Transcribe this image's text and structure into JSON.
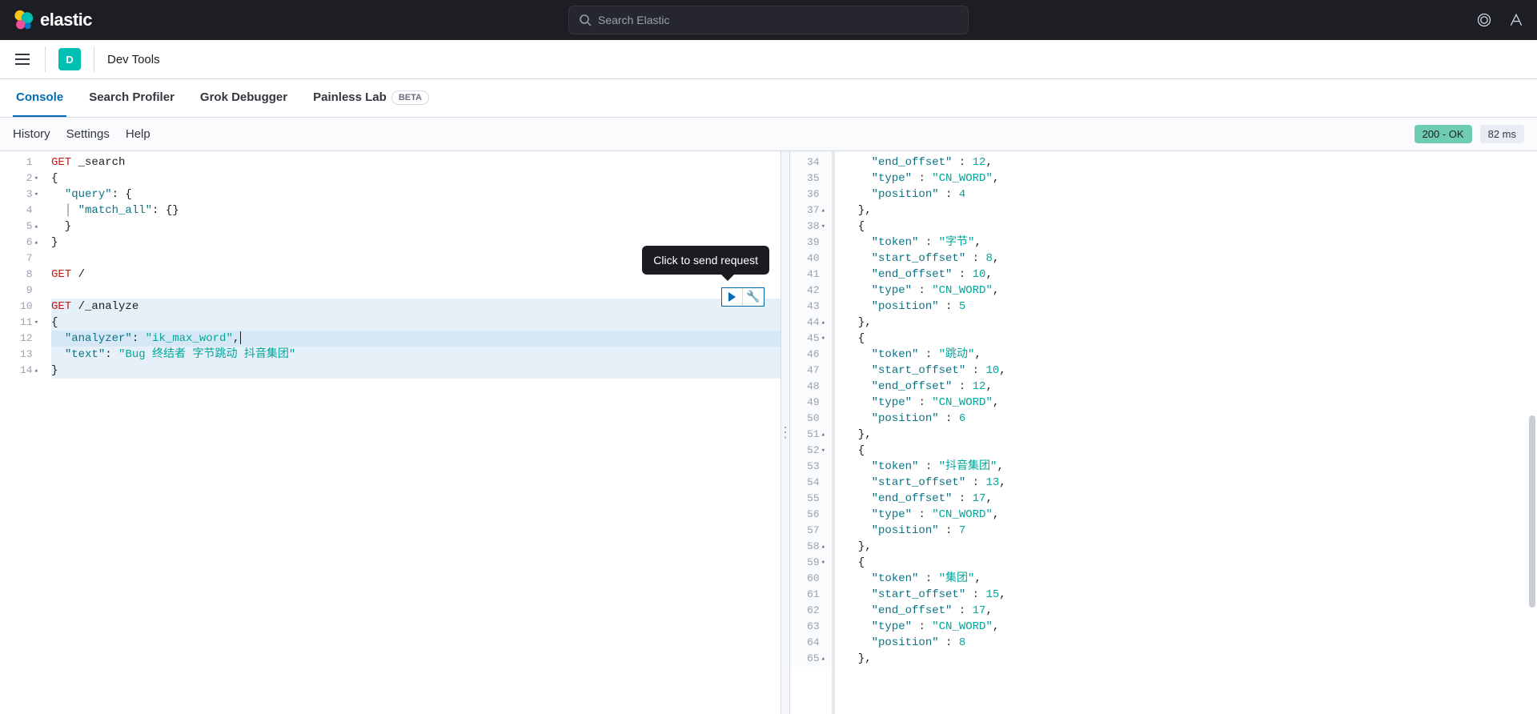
{
  "header": {
    "brand": "elastic",
    "search_placeholder": "Search Elastic"
  },
  "subheader": {
    "badge_letter": "D",
    "breadcrumb": "Dev Tools"
  },
  "tabs": {
    "console": "Console",
    "search_profiler": "Search Profiler",
    "grok_debugger": "Grok Debugger",
    "painless_lab": "Painless Lab",
    "beta": "BETA"
  },
  "toolbar": {
    "history": "History",
    "settings": "Settings",
    "help": "Help",
    "status": "200 - OK",
    "time": "82 ms"
  },
  "tooltip": "Click to send request",
  "request": {
    "lines": [
      {
        "n": "1",
        "f": "",
        "h": 0,
        "html": "<span class='kw'>GET</span> <span class='pth'>_search</span>"
      },
      {
        "n": "2",
        "f": "▾",
        "h": 0,
        "html": "{"
      },
      {
        "n": "3",
        "f": "▾",
        "h": 0,
        "html": "  <span class='str'>\"query\"</span>: {"
      },
      {
        "n": "4",
        "f": "",
        "h": 0,
        "html": "  <span class='pun'>│</span> <span class='str'>\"match_all\"</span>: {}"
      },
      {
        "n": "5",
        "f": "▴",
        "h": 0,
        "html": "  }"
      },
      {
        "n": "6",
        "f": "▴",
        "h": 0,
        "html": "}"
      },
      {
        "n": "7",
        "f": "",
        "h": 0,
        "html": ""
      },
      {
        "n": "8",
        "f": "",
        "h": 0,
        "html": "<span class='kw'>GET</span> <span class='pth'>/</span>"
      },
      {
        "n": "9",
        "f": "",
        "h": 0,
        "html": ""
      },
      {
        "n": "10",
        "f": "",
        "h": 1,
        "html": "<span class='kw'>GET</span> <span class='pth'>/_analyze</span>"
      },
      {
        "n": "11",
        "f": "▾",
        "h": 1,
        "html": "{"
      },
      {
        "n": "12",
        "f": "",
        "h": 2,
        "html": "  <span class='str'>\"analyzer\"</span>: <span class='grn'>\"ik_max_word\"</span>,<span class='cursor-bar'></span>"
      },
      {
        "n": "13",
        "f": "",
        "h": 1,
        "html": "  <span class='str'>\"text\"</span>: <span class='grn'>\"Bug 终结者 字节跳动 抖音集团\"</span>"
      },
      {
        "n": "14",
        "f": "▴",
        "h": 1,
        "html": "}"
      }
    ]
  },
  "response": {
    "lines": [
      {
        "n": "34",
        "f": "",
        "html": "    <span class='r-key'>\"end_offset\"</span> <span class='r-pun'>:</span> <span class='r-num'>12</span>,"
      },
      {
        "n": "35",
        "f": "",
        "html": "    <span class='r-key'>\"type\"</span> <span class='r-pun'>:</span> <span class='r-str'>\"CN_WORD\"</span>,"
      },
      {
        "n": "36",
        "f": "",
        "html": "    <span class='r-key'>\"position\"</span> <span class='r-pun'>:</span> <span class='r-num'>4</span>"
      },
      {
        "n": "37",
        "f": "▴",
        "html": "  },"
      },
      {
        "n": "38",
        "f": "▾",
        "html": "  {"
      },
      {
        "n": "39",
        "f": "",
        "html": "    <span class='r-key'>\"token\"</span> <span class='r-pun'>:</span> <span class='r-str'>\"字节\"</span>,"
      },
      {
        "n": "40",
        "f": "",
        "html": "    <span class='r-key'>\"start_offset\"</span> <span class='r-pun'>:</span> <span class='r-num'>8</span>,"
      },
      {
        "n": "41",
        "f": "",
        "html": "    <span class='r-key'>\"end_offset\"</span> <span class='r-pun'>:</span> <span class='r-num'>10</span>,"
      },
      {
        "n": "42",
        "f": "",
        "html": "    <span class='r-key'>\"type\"</span> <span class='r-pun'>:</span> <span class='r-str'>\"CN_WORD\"</span>,"
      },
      {
        "n": "43",
        "f": "",
        "html": "    <span class='r-key'>\"position\"</span> <span class='r-pun'>:</span> <span class='r-num'>5</span>"
      },
      {
        "n": "44",
        "f": "▴",
        "html": "  },"
      },
      {
        "n": "45",
        "f": "▾",
        "html": "  {"
      },
      {
        "n": "46",
        "f": "",
        "html": "    <span class='r-key'>\"token\"</span> <span class='r-pun'>:</span> <span class='r-str'>\"跳动\"</span>,"
      },
      {
        "n": "47",
        "f": "",
        "html": "    <span class='r-key'>\"start_offset\"</span> <span class='r-pun'>:</span> <span class='r-num'>10</span>,"
      },
      {
        "n": "48",
        "f": "",
        "html": "    <span class='r-key'>\"end_offset\"</span> <span class='r-pun'>:</span> <span class='r-num'>12</span>,"
      },
      {
        "n": "49",
        "f": "",
        "html": "    <span class='r-key'>\"type\"</span> <span class='r-pun'>:</span> <span class='r-str'>\"CN_WORD\"</span>,"
      },
      {
        "n": "50",
        "f": "",
        "html": "    <span class='r-key'>\"position\"</span> <span class='r-pun'>:</span> <span class='r-num'>6</span>"
      },
      {
        "n": "51",
        "f": "▴",
        "html": "  },"
      },
      {
        "n": "52",
        "f": "▾",
        "html": "  {"
      },
      {
        "n": "53",
        "f": "",
        "html": "    <span class='r-key'>\"token\"</span> <span class='r-pun'>:</span> <span class='r-str'>\"抖音集团\"</span>,"
      },
      {
        "n": "54",
        "f": "",
        "html": "    <span class='r-key'>\"start_offset\"</span> <span class='r-pun'>:</span> <span class='r-num'>13</span>,"
      },
      {
        "n": "55",
        "f": "",
        "html": "    <span class='r-key'>\"end_offset\"</span> <span class='r-pun'>:</span> <span class='r-num'>17</span>,"
      },
      {
        "n": "56",
        "f": "",
        "html": "    <span class='r-key'>\"type\"</span> <span class='r-pun'>:</span> <span class='r-str'>\"CN_WORD\"</span>,"
      },
      {
        "n": "57",
        "f": "",
        "html": "    <span class='r-key'>\"position\"</span> <span class='r-pun'>:</span> <span class='r-num'>7</span>"
      },
      {
        "n": "58",
        "f": "▴",
        "html": "  },"
      },
      {
        "n": "59",
        "f": "▾",
        "html": "  {"
      },
      {
        "n": "60",
        "f": "",
        "html": "    <span class='r-key'>\"token\"</span> <span class='r-pun'>:</span> <span class='r-str'>\"集团\"</span>,"
      },
      {
        "n": "61",
        "f": "",
        "html": "    <span class='r-key'>\"start_offset\"</span> <span class='r-pun'>:</span> <span class='r-num'>15</span>,"
      },
      {
        "n": "62",
        "f": "",
        "html": "    <span class='r-key'>\"end_offset\"</span> <span class='r-pun'>:</span> <span class='r-num'>17</span>,"
      },
      {
        "n": "63",
        "f": "",
        "html": "    <span class='r-key'>\"type\"</span> <span class='r-pun'>:</span> <span class='r-str'>\"CN_WORD\"</span>,"
      },
      {
        "n": "64",
        "f": "",
        "html": "    <span class='r-key'>\"position\"</span> <span class='r-pun'>:</span> <span class='r-num'>8</span>"
      },
      {
        "n": "65",
        "f": "▴",
        "html": "  },"
      }
    ]
  }
}
